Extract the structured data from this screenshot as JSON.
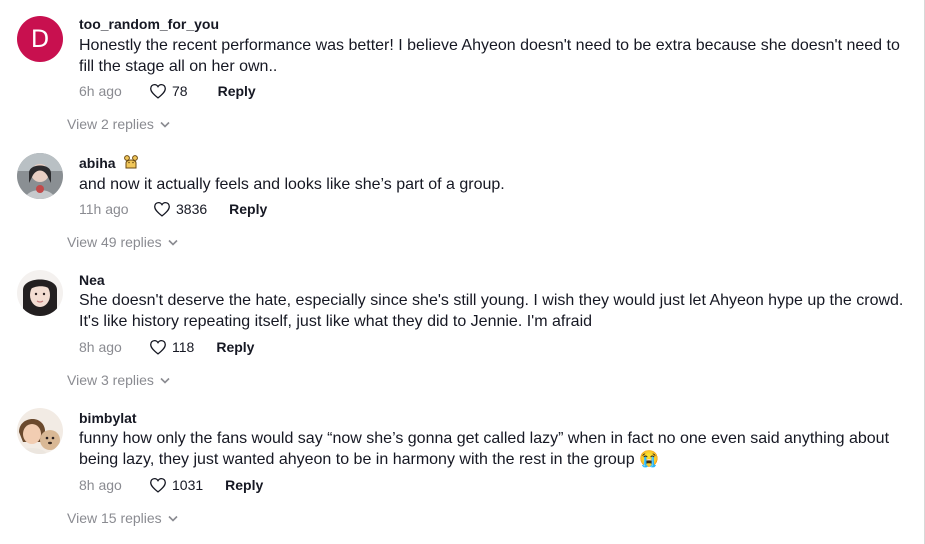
{
  "comments": [
    {
      "username": "too_random_for_you",
      "avatar_letter": "D",
      "text": "Honestly the recent performance was better! I believe Ahyeon doesn't need to be extra because she doesn't need to fill the stage all on her own..",
      "time": "6h ago",
      "likes": "78",
      "reply_label": "Reply",
      "view_replies": "View 2 replies"
    },
    {
      "username": "abiha",
      "text": "and now it actually feels and looks like she’s part of a group.",
      "time": "11h ago",
      "likes": "3836",
      "reply_label": "Reply",
      "view_replies": "View 49 replies"
    },
    {
      "username": "Nea",
      "text": "She doesn't deserve the hate, especially since she's still young. I wish they would just let Ahyeon hype up the crowd. It's like history repeating itself, just like what they did to Jennie. I'm afraid",
      "time": "8h ago",
      "likes": "118",
      "reply_label": "Reply",
      "view_replies": "View 3 replies"
    },
    {
      "username": "bimbylat",
      "text": "funny how only the fans would say “now she’s gonna get called lazy” when in fact no one even said anything about being lazy, they just wanted ahyeon to be in harmony with the rest in the group 😭",
      "time": "8h ago",
      "likes": "1031",
      "reply_label": "Reply",
      "view_replies": "View 15 replies"
    }
  ],
  "colors": {
    "avatar_letter_bg": "#c8104f",
    "muted_text": "#8a8b91",
    "primary_text": "#161823"
  },
  "icons": {
    "like": "heart-outline-icon",
    "expand": "chevron-down-icon",
    "badge": "bear-badge-icon",
    "emoji": "loudly-crying-face-emoji"
  }
}
